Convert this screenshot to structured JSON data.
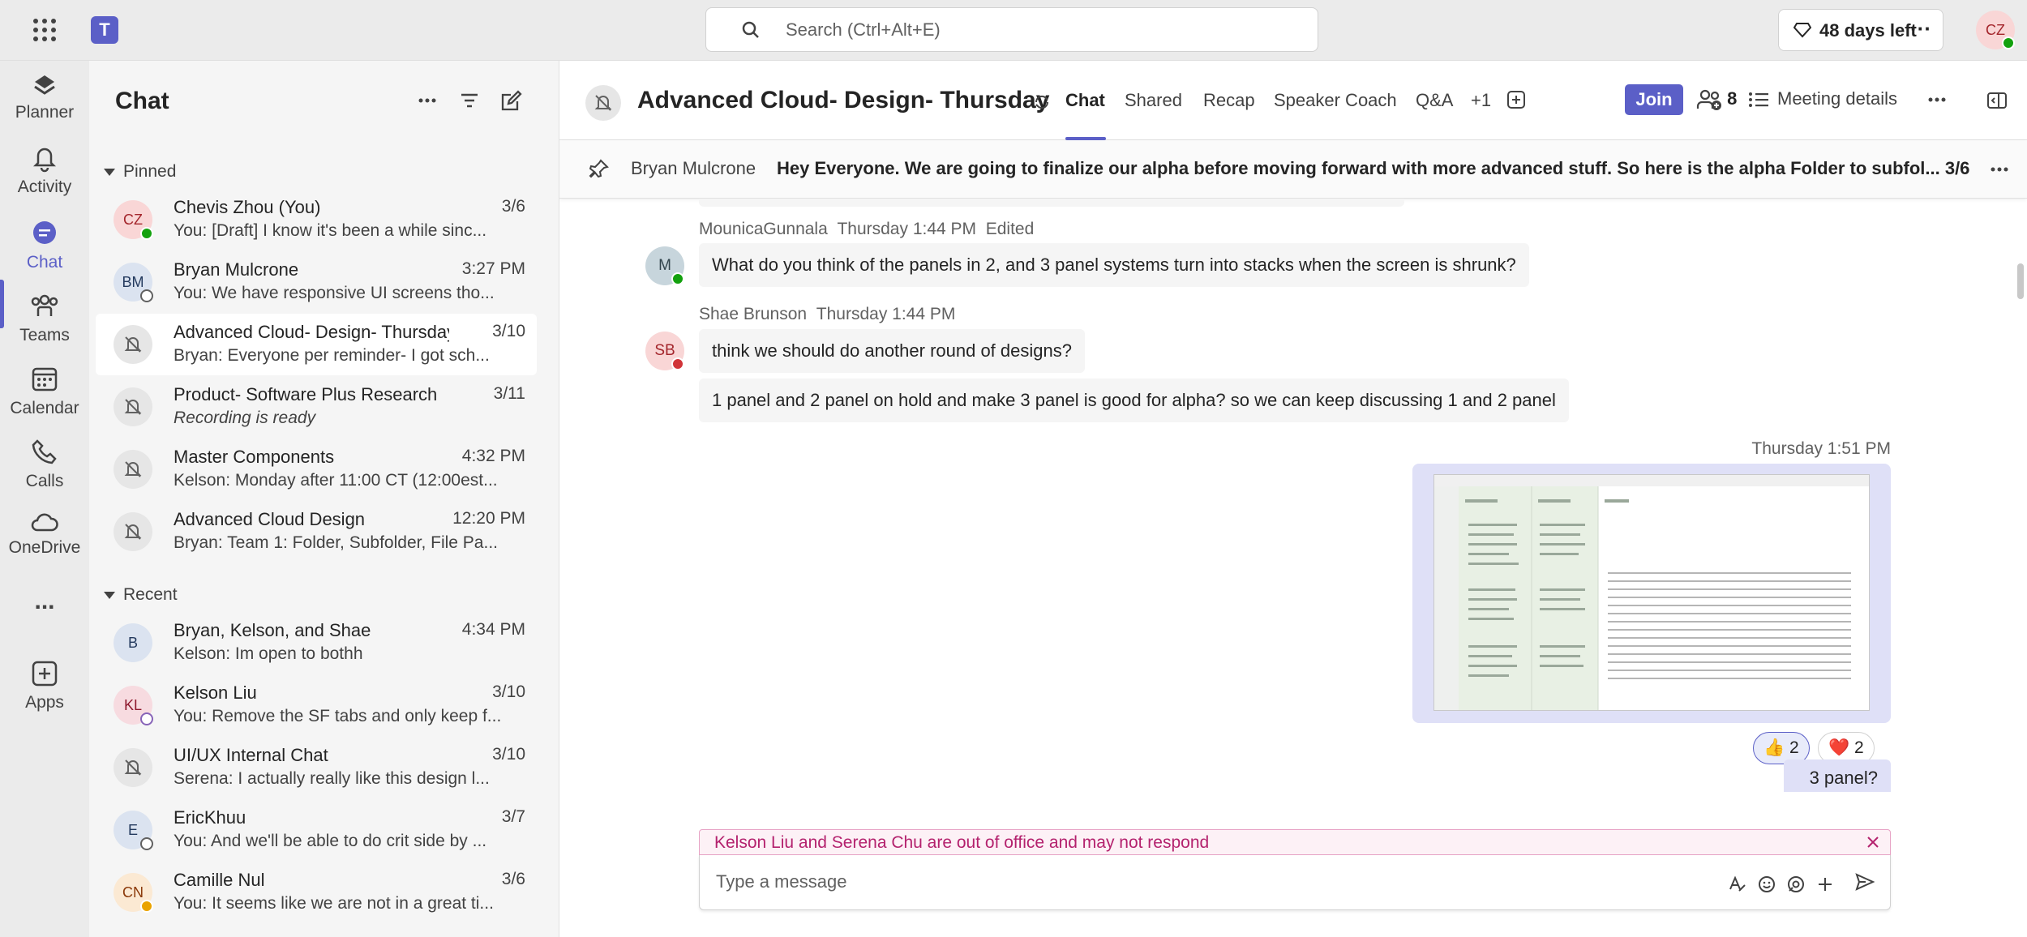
{
  "topbar": {
    "search_placeholder": "Search (Ctrl+Alt+E)",
    "trial_label": "48 days left",
    "user_initials": "CZ"
  },
  "rail": {
    "items": [
      {
        "label": "Planner",
        "icon": "planner-icon"
      },
      {
        "label": "Activity",
        "icon": "bell-icon"
      },
      {
        "label": "Chat",
        "icon": "chat-icon"
      },
      {
        "label": "Teams",
        "icon": "teams-icon"
      },
      {
        "label": "Calendar",
        "icon": "calendar-icon"
      },
      {
        "label": "Calls",
        "icon": "phone-icon"
      },
      {
        "label": "OneDrive",
        "icon": "cloud-icon"
      },
      {
        "label": "Apps",
        "icon": "add-app-icon"
      }
    ],
    "more_label": "..."
  },
  "chatlist": {
    "title": "Chat",
    "pinned_label": "Pinned",
    "recent_label": "Recent",
    "pinned": [
      {
        "initials": "CZ",
        "name": "Chevis Zhou (You)",
        "time": "3/6",
        "preview": "You: [Draft]  I know it's been a while sinc..."
      },
      {
        "initials": "BM",
        "name": "Bryan Mulcrone",
        "time": "3:27 PM",
        "preview": "You: We have responsive UI screens tho..."
      },
      {
        "initials": "",
        "name": "Advanced Cloud- Design- Thursday",
        "time": "3/10",
        "preview": "Bryan: Everyone per reminder- I got sch..."
      },
      {
        "initials": "",
        "name": "Product- Software Plus Research",
        "time": "3/11",
        "preview": "Recording is ready"
      },
      {
        "initials": "",
        "name": "Master Components",
        "time": "4:32 PM",
        "preview": "Kelson: Monday after 11:00 CT (12:00est..."
      },
      {
        "initials": "",
        "name": "Advanced Cloud Design",
        "time": "12:20 PM",
        "preview": "Bryan: Team 1: Folder, Subfolder, File Pa..."
      }
    ],
    "recent": [
      {
        "initials": "B",
        "name": "Bryan, Kelson, and Shae",
        "time": "4:34 PM",
        "preview": "Kelson: Im open to bothh"
      },
      {
        "initials": "KL",
        "name": "Kelson Liu",
        "time": "3/10",
        "preview": "You: Remove the SF tabs and only keep f..."
      },
      {
        "initials": "",
        "name": "UI/UX Internal Chat",
        "time": "3/10",
        "preview": "Serena: I actually really like this design l..."
      },
      {
        "initials": "E",
        "name": "EricKhuu",
        "time": "3/7",
        "preview": "You: And we'll be able to do crit side by ..."
      },
      {
        "initials": "CN",
        "name": "Camille Nul",
        "time": "3/6",
        "preview": "You: It seems like we are not in a great ti..."
      }
    ]
  },
  "conversation": {
    "title": "Advanced Cloud- Design- Thursday",
    "tabs": [
      "Chat",
      "Shared",
      "Recap",
      "Speaker Coach",
      "Q&A",
      "+1"
    ],
    "join_label": "Join",
    "participants_count": "8",
    "meeting_details_label": "Meeting details",
    "pinned": {
      "author": "Bryan Mulcrone",
      "message": "Hey Everyone. We are going to finalize our alpha before moving forward with more advanced stuff. So here is the alpha Folder to subfol... 3/6"
    },
    "messages": [
      {
        "avatar": "M",
        "author": "MounicaGunnala",
        "time": "Thursday 1:44 PM",
        "edited": "Edited",
        "text": "What do you think of the panels in 2, and 3 panel systems turn into stacks when the screen is shrunk?"
      },
      {
        "avatar": "SB",
        "author": "Shae Brunson",
        "time": "Thursday 1:44 PM",
        "text": "think we should do another round of designs?",
        "text2": "1 panel and 2 panel on hold and make 3 panel is good for alpha? so we can keep discussing 1 and 2 panel"
      }
    ],
    "my_message": {
      "time": "Thursday 1:51 PM",
      "reactions": [
        {
          "emoji": "👍",
          "count": "2"
        },
        {
          "emoji": "❤️",
          "count": "2"
        }
      ],
      "text": "3 panel?"
    },
    "oof_notice": "Kelson Liu and Serena Chu are out of office and may not respond",
    "compose_placeholder": "Type a message"
  },
  "colors": {
    "brand": "#5b5fc7",
    "rail_bg": "#ebebeb",
    "list_bg": "#f5f5f5"
  }
}
